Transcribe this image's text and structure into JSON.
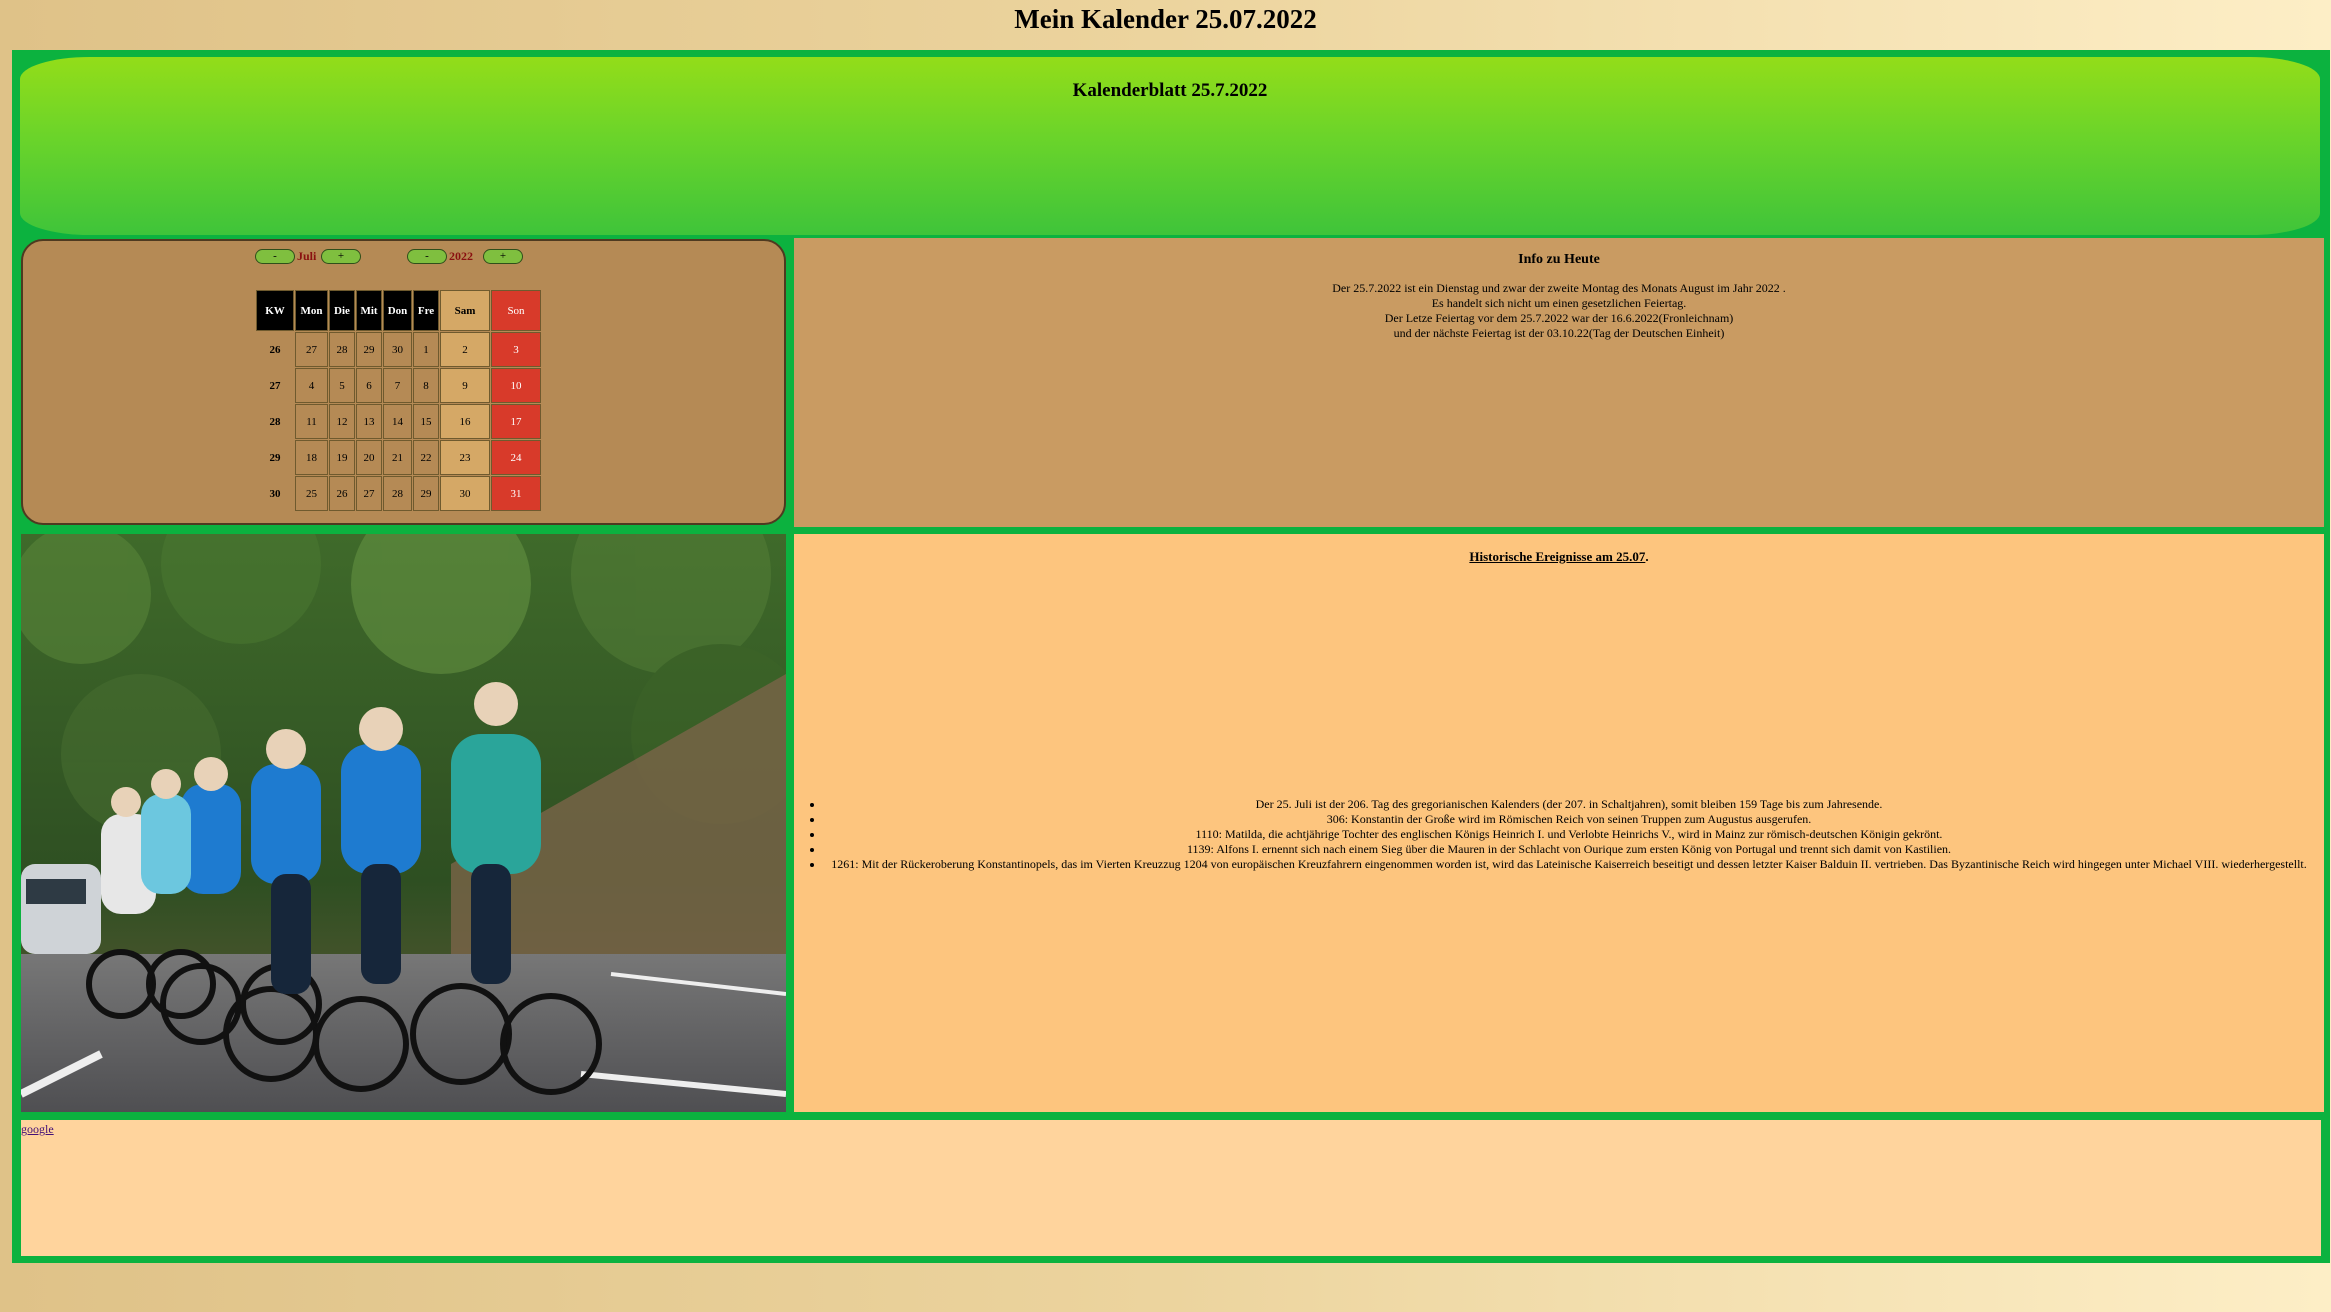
{
  "page": {
    "title": "Mein Kalender 25.07.2022"
  },
  "header": {
    "title": "Kalenderblatt 25.7.2022"
  },
  "calendar": {
    "month_minus": "-",
    "month_label": "Juli",
    "month_plus": "+",
    "year_minus": "-",
    "year_label": "2022",
    "year_plus": "+",
    "columns": [
      "KW",
      "Mon",
      "Die",
      "Mit",
      "Don",
      "Fre",
      "Sam",
      "Son"
    ],
    "rows": [
      [
        "26",
        "27",
        "28",
        "29",
        "30",
        "1",
        "2",
        "3"
      ],
      [
        "27",
        "4",
        "5",
        "6",
        "7",
        "8",
        "9",
        "10"
      ],
      [
        "28",
        "11",
        "12",
        "13",
        "14",
        "15",
        "16",
        "17"
      ],
      [
        "29",
        "18",
        "19",
        "20",
        "21",
        "22",
        "23",
        "24"
      ],
      [
        "30",
        "25",
        "26",
        "27",
        "28",
        "29",
        "30",
        "31"
      ]
    ]
  },
  "info": {
    "title": "Info zu Heute",
    "lines": [
      "Der 25.7.2022 ist ein Dienstag und zwar der zweite Montag des Monats August im Jahr 2022 .",
      "Es handelt sich nicht um einen gesetzlichen Feiertag.",
      "Der Letze Feiertag vor dem 25.7.2022 war der 16.6.2022(Fronleichnam)",
      "und der nächste Feiertag ist der 03.10.22(Tag der Deutschen Einheit)"
    ]
  },
  "photo": {
    "alt": "Radrennen"
  },
  "history": {
    "title_link": "Historische Ereignisse am 25.07",
    "title_suffix": ".",
    "items": [
      "Der 25. Juli ist der 206. Tag des gregorianischen Kalenders (der 207. in Schaltjahren), somit bleiben 159 Tage bis zum Jahresende.",
      "306: Konstantin der Große wird im Römischen Reich von seinen Truppen zum Augustus ausgerufen.",
      "1110: Matilda, die achtjährige Tochter des englischen Königs Heinrich I. und Verlobte Heinrichs V., wird in Mainz zur römisch-deutschen Königin gekrönt.",
      "1139: Alfons I. ernennt sich nach einem Sieg über die Mauren in der Schlacht von Ourique zum ersten König von Portugal und trennt sich damit von Kastilien.",
      "1261: Mit der Rückeroberung Konstantinopels, das im Vierten Kreuzzug 1204 von europäischen Kreuzfahrern eingenommen worden ist, wird das Lateinische Kaiserreich beseitigt und dessen letzter Kaiser Balduin II. vertrieben. Das Byzantinische Reich wird hingegen unter Michael VIII. wiederhergestellt."
    ]
  },
  "footer": {
    "link": "google"
  },
  "colors": {
    "frame": "#0cb23f",
    "header_green": "#93dd19",
    "calendar_bg": "#b58a55",
    "info_bg": "#c99b62",
    "history_bg": "#fdc57e",
    "footer_bg": "#ffd49d",
    "sunday": "#d83a2a",
    "saturday": "#d5a866"
  }
}
